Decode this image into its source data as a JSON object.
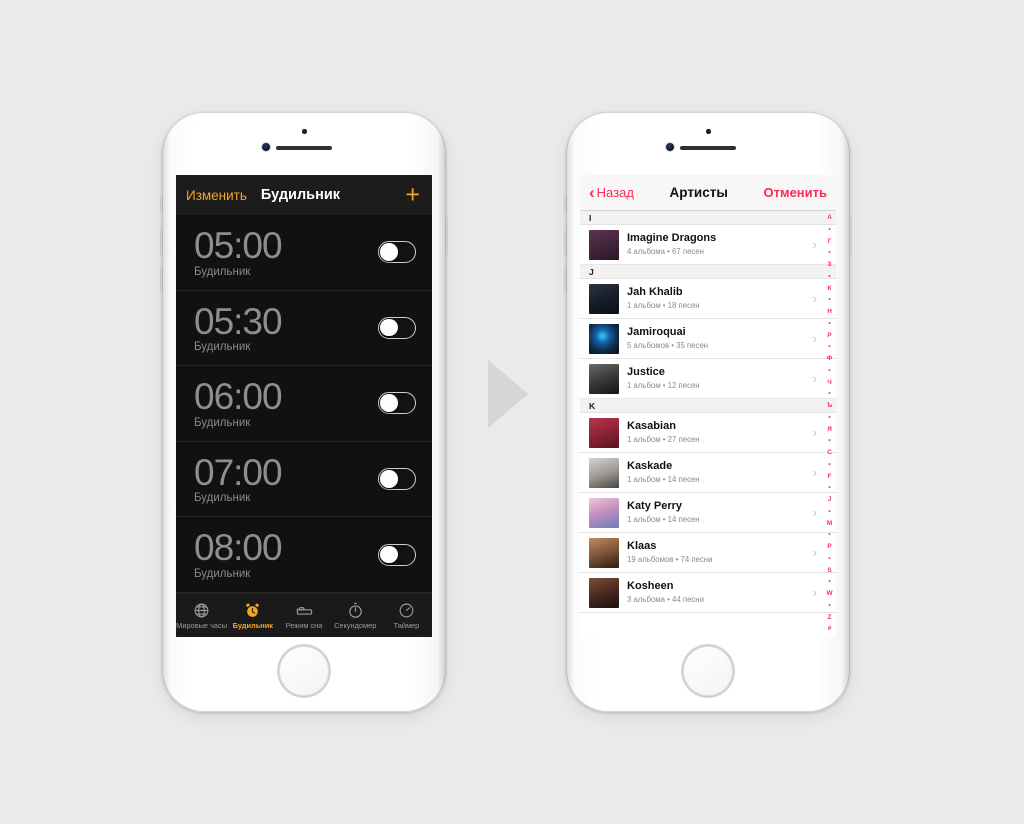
{
  "background_color": "#eaeaea",
  "arrow": {
    "name": "transition-arrow",
    "color": "#d6d6d6"
  },
  "left_phone": {
    "device": "iPhone white",
    "app": "Clock",
    "nav": {
      "edit_label": "Изменить",
      "title": "Будильник",
      "add_icon": "+",
      "accent_color": "#f5a623"
    },
    "alarms": [
      {
        "time": "05:00",
        "label": "Будильник",
        "enabled": false
      },
      {
        "time": "05:30",
        "label": "Будильник",
        "enabled": false
      },
      {
        "time": "06:00",
        "label": "Будильник",
        "enabled": false
      },
      {
        "time": "07:00",
        "label": "Будильник",
        "enabled": false
      },
      {
        "time": "08:00",
        "label": "Будильник",
        "enabled": false
      }
    ],
    "tabs": [
      {
        "label": "Мировые часы",
        "icon": "globe-icon",
        "active": false
      },
      {
        "label": "Будильник",
        "icon": "alarm-clock-icon",
        "active": true
      },
      {
        "label": "Режим сна",
        "icon": "bed-icon",
        "active": false
      },
      {
        "label": "Секундомер",
        "icon": "stopwatch-icon",
        "active": false
      },
      {
        "label": "Таймер",
        "icon": "timer-icon",
        "active": false
      }
    ]
  },
  "right_phone": {
    "device": "iPhone white",
    "app": "Music",
    "nav": {
      "back_label": "Назад",
      "title": "Артисты",
      "cancel_label": "Отменить",
      "accent_color": "#fb2b56"
    },
    "sections": [
      {
        "letter": "I",
        "artists": [
          {
            "name": "Imagine Dragons",
            "detail": "4 альбома • 67 песен"
          }
        ]
      },
      {
        "letter": "J",
        "artists": [
          {
            "name": "Jah Khalib",
            "detail": "1 альбом • 18 песен"
          },
          {
            "name": "Jamiroquai",
            "detail": "5 альбомов • 35 песен"
          },
          {
            "name": "Justice",
            "detail": "1 альбом • 12 песен"
          }
        ]
      },
      {
        "letter": "K",
        "artists": [
          {
            "name": "Kasabian",
            "detail": "1 альбом • 27 песен"
          },
          {
            "name": "Kaskade",
            "detail": "1 альбом • 14 песен"
          },
          {
            "name": "Katy Perry",
            "detail": "1 альбом • 14 песен"
          },
          {
            "name": "Klaas",
            "detail": "19 альбомов • 74 песни"
          },
          {
            "name": "Kosheen",
            "detail": "3 альбома • 44 песни"
          }
        ]
      }
    ],
    "index_letters": [
      "А",
      "•",
      "Г",
      "•",
      "З",
      "•",
      "К",
      "•",
      "Н",
      "•",
      "Р",
      "•",
      "Ф",
      "•",
      "Ч",
      "•",
      "Ъ",
      "•",
      "Я",
      "•",
      "C",
      "•",
      "F",
      "•",
      "J",
      "•",
      "M",
      "•",
      "P",
      "•",
      "S",
      "•",
      "W",
      "•",
      "Z",
      "#"
    ]
  }
}
